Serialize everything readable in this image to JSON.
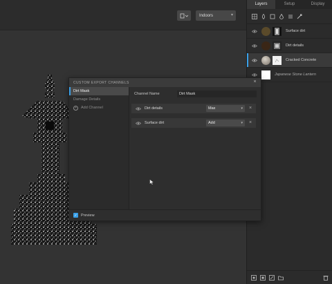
{
  "toolbar": {
    "environment_value": "Indoors"
  },
  "right_panel": {
    "tabs": [
      {
        "label": "Layers",
        "active": true
      },
      {
        "label": "Setup",
        "active": false
      },
      {
        "label": "Display",
        "active": false
      }
    ],
    "tool_icons": [
      "grid-icon",
      "paint-icon",
      "square-icon",
      "droplet-icon",
      "list-icon",
      "brush-icon"
    ],
    "layers": [
      {
        "name": "Surface dirt",
        "italic": true,
        "swatch": "#5a4a2a",
        "active": false
      },
      {
        "name": "Dirt details",
        "italic": true,
        "swatch": "#3a2616",
        "active": false
      },
      {
        "name": "Cracked Concrete",
        "italic": false,
        "swatch": "#a8a098",
        "active": true
      },
      {
        "name": "Japanese Stone Lantern",
        "italic": true,
        "swatch": "#ffffff",
        "active": false
      }
    ],
    "bottom_icons": [
      "new-layer-icon",
      "group-icon",
      "mask-icon",
      "folder-icon",
      "trash-icon"
    ]
  },
  "dialog": {
    "title": "CUSTOM EXPORT CHANNELS",
    "channels": [
      {
        "label": "Dirt Mask",
        "active": true
      },
      {
        "label": "Damage Details",
        "active": false
      }
    ],
    "add_channel_label": "Add Channel",
    "channel_name_label": "Channel Name",
    "channel_name_value": "Dirt Mask",
    "sources": [
      {
        "name": "Dirt details",
        "blend": "Max"
      },
      {
        "name": "Surface dirt",
        "blend": "Add"
      }
    ],
    "preview_label": "Preview",
    "preview_checked": true
  },
  "colors": {
    "accent": "#3aa0e8",
    "panel_bg": "#2b2b2b",
    "viewport_bg": "#333333"
  }
}
